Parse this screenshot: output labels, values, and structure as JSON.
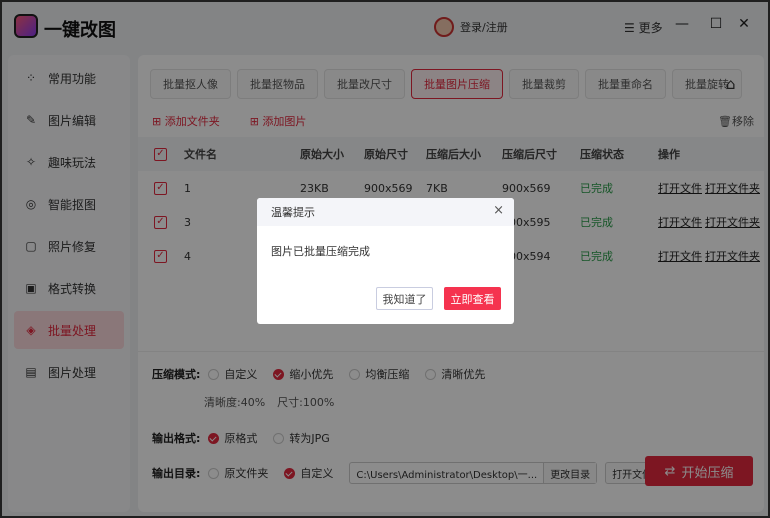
{
  "app": {
    "title": "一键改图",
    "user_label": "登录/注册",
    "more_label": "更多",
    "min": "—",
    "max": "☐",
    "close": "✕"
  },
  "sidebar": {
    "items": [
      {
        "label": "常用功能",
        "icon": "grid-icon",
        "glyph": "⁘"
      },
      {
        "label": "图片编辑",
        "icon": "edit-icon",
        "glyph": "✎"
      },
      {
        "label": "趣味玩法",
        "icon": "fun-icon",
        "glyph": "✧"
      },
      {
        "label": "智能抠图",
        "icon": "target-icon",
        "glyph": "◎"
      },
      {
        "label": "照片修复",
        "icon": "repair-icon",
        "glyph": "▢"
      },
      {
        "label": "格式转换",
        "icon": "convert-icon",
        "glyph": "▣"
      },
      {
        "label": "批量处理",
        "icon": "layers-icon",
        "glyph": "◈",
        "active": true
      },
      {
        "label": "图片处理",
        "icon": "image-icon",
        "glyph": "▤"
      }
    ]
  },
  "tabs": [
    "批量抠人像",
    "批量抠物品",
    "批量改尺寸",
    "批量图片压缩",
    "批量裁剪",
    "批量重命名",
    "批量旋转"
  ],
  "active_tab": 3,
  "toolbar": {
    "add_folder": "添加文件夹",
    "add_image": "添加图片",
    "remove": "移除"
  },
  "table": {
    "headers": [
      "文件名",
      "原始大小",
      "原始尺寸",
      "压缩后大小",
      "压缩后尺寸",
      "压缩状态",
      "操作"
    ],
    "rows": [
      {
        "name": "1",
        "orig_size": "23KB",
        "orig_dim": "900x569",
        "new_size": "7KB",
        "new_dim": "900x569",
        "status": "已完成",
        "open_file": "打开文件",
        "open_folder": "打开文件夹"
      },
      {
        "name": "3",
        "orig_size": "",
        "orig_dim": "",
        "new_size": "",
        "new_dim": "900x595",
        "status": "已完成",
        "open_file": "打开文件",
        "open_folder": "打开文件夹"
      },
      {
        "name": "4",
        "orig_size": "",
        "orig_dim": "",
        "new_size": "",
        "new_dim": "900x594",
        "status": "已完成",
        "open_file": "打开文件",
        "open_folder": "打开文件夹"
      }
    ]
  },
  "settings": {
    "mode_label": "压缩模式:",
    "modes": [
      "自定义",
      "缩小优先",
      "均衡压缩",
      "清晰优先"
    ],
    "mode_selected": 1,
    "clarity": "清晰度:40%",
    "size": "尺寸:100%",
    "format_label": "输出格式:",
    "formats": [
      "原格式",
      "转为JPG"
    ],
    "format_selected": 0,
    "dir_label": "输出目录:",
    "dirs": [
      "原文件夹",
      "自定义"
    ],
    "dir_selected": 1,
    "path": "C:\\Users\\Administrator\\Desktop\\一...",
    "change_dir": "更改目录",
    "open_folder": "打开文件夹",
    "start": "开始压缩"
  },
  "dialog": {
    "title": "温馨提示",
    "message": "图片已批量压缩完成",
    "dismiss": "我知道了",
    "view": "立即查看",
    "close": "×"
  },
  "colors": {
    "accent": "#e3283e",
    "success": "#2a9d4a"
  }
}
